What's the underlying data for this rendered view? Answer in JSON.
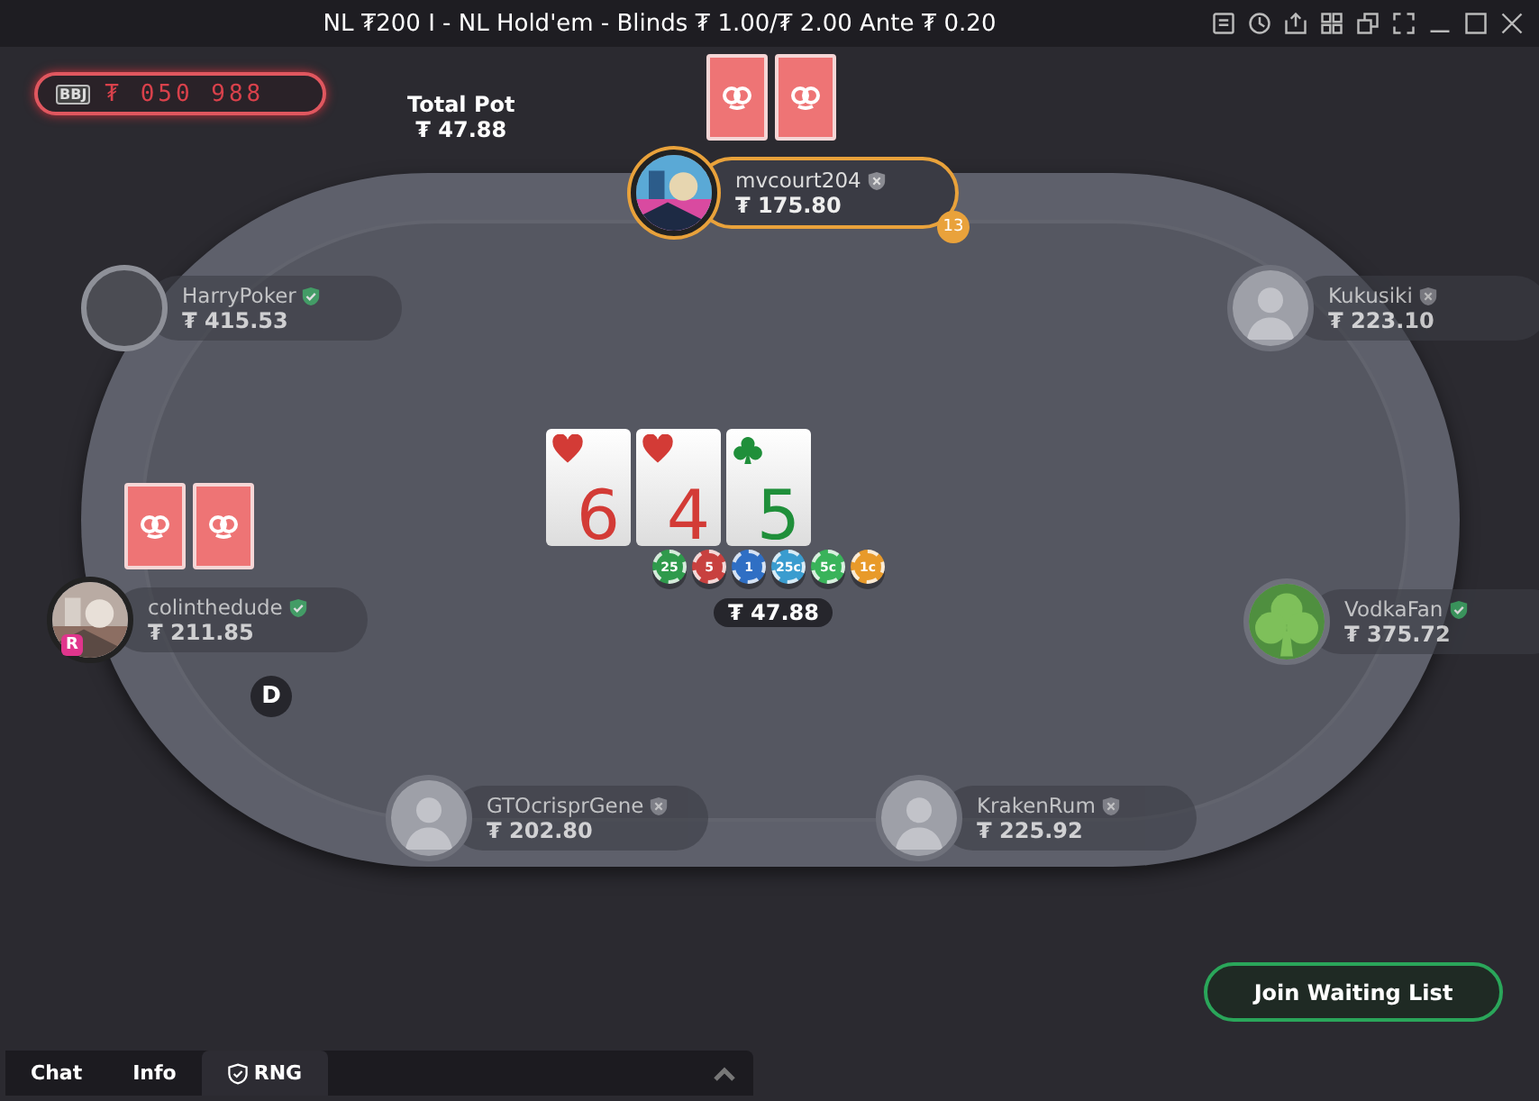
{
  "window": {
    "title": "NL ₮200 I - NL Hold'em - Blinds ₮ 1.00/₮ 2.00 Ante ₮ 0.20"
  },
  "jackpot": {
    "badge": "BBJ",
    "amount": "₮ 050 988"
  },
  "total_pot": {
    "label": "Total Pot",
    "amount": "₮ 47.88"
  },
  "seats": [
    {
      "name": "mvcourt204",
      "stack": "₮ 175.80",
      "verified": false,
      "active": true,
      "timer": "13",
      "cards_shown": true
    },
    {
      "name": "HarryPoker",
      "stack": "₮ 415.53",
      "verified": true,
      "kind": "empty",
      "active": false,
      "cards_shown": false
    },
    {
      "name": "Kukusiki",
      "stack": "₮ 223.10",
      "verified": false,
      "kind": "silhouette",
      "active": false,
      "cards_shown": false
    },
    {
      "name": "colinthedude",
      "stack": "₮ 211.85",
      "verified": true,
      "active": false,
      "cards_shown": true,
      "badge": "R"
    },
    {
      "name": "VodkaFan",
      "stack": "₮ 375.72",
      "verified": true,
      "kind": "clover",
      "active": false,
      "cards_shown": false
    },
    {
      "name": "GTOcrisprGene",
      "stack": "₮ 202.80",
      "verified": false,
      "kind": "silhouette",
      "active": false,
      "cards_shown": false
    },
    {
      "name": "KrakenRum",
      "stack": "₮ 225.92",
      "verified": false,
      "kind": "silhouette",
      "active": false,
      "cards_shown": false
    }
  ],
  "dealer_button": "D",
  "board": [
    {
      "rank": "6",
      "kind": "hearts"
    },
    {
      "rank": "4",
      "kind": "hearts"
    },
    {
      "rank": "5",
      "kind": "clubs"
    }
  ],
  "chips": [
    {
      "label": "25",
      "color": "#2f9a4c"
    },
    {
      "label": "5",
      "color": "#c8413f"
    },
    {
      "label": "1",
      "color": "#2f6fc4"
    },
    {
      "label": "25c",
      "color": "#3a9ccf"
    },
    {
      "label": "5c",
      "color": "#39b35a"
    },
    {
      "label": "1c",
      "color": "#e89a2a"
    }
  ],
  "pot": "₮ 47.88",
  "waiting_list_button": "Join Waiting List",
  "bottom_tabs": [
    {
      "label": "Chat",
      "selected": false
    },
    {
      "label": "Info",
      "selected": false
    },
    {
      "label": "RNG",
      "selected": true,
      "kind": "shield"
    }
  ]
}
